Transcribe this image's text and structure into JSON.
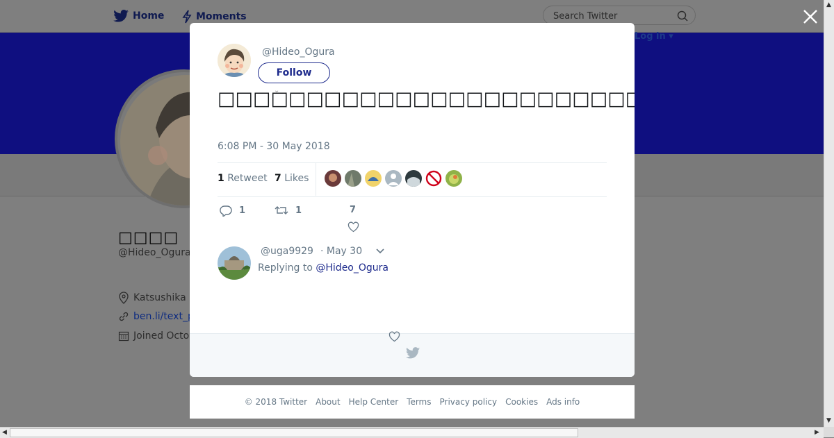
{
  "nav": {
    "home": "Home",
    "moments": "Moments",
    "login": "Log in",
    "search_placeholder": "Search Twitter"
  },
  "profile": {
    "name": "□□□□",
    "handle": "@Hideo_Ogura",
    "location": "Katsushika",
    "website": "ben.li/text_p",
    "joined": "Joined Octo"
  },
  "tweet": {
    "handle": "@Hideo_Ogura",
    "follow_label": "Follow",
    "text": "□□□□□□□□□□□□□□□□□□□□□□□□□□□□□□□□□□□□□□□□□□□□□□□□□□□□□□□□□□□□□□□□□□□□□□□□□□□□□□□□□",
    "timestamp": "6:08 PM - 30 May 2018",
    "retweets_count": "1",
    "retweets_label": "Retweet",
    "likes_count": "7",
    "likes_label": "Likes",
    "actions": {
      "replies": "1",
      "retweets": "1",
      "likes": "7"
    }
  },
  "reply": {
    "handle": "@uga9929",
    "date": "· May 30",
    "replying_prefix": "Replying to",
    "replying_to": "@Hideo_Ogura"
  },
  "footer": {
    "links": [
      "© 2018 Twitter",
      "About",
      "Help Center",
      "Terms",
      "Privacy policy",
      "Cookies",
      "Ads info"
    ]
  },
  "colors": {
    "accent": "#1d2a8c",
    "banner": "#0f0f80",
    "overlay": "#7f7f7f"
  }
}
